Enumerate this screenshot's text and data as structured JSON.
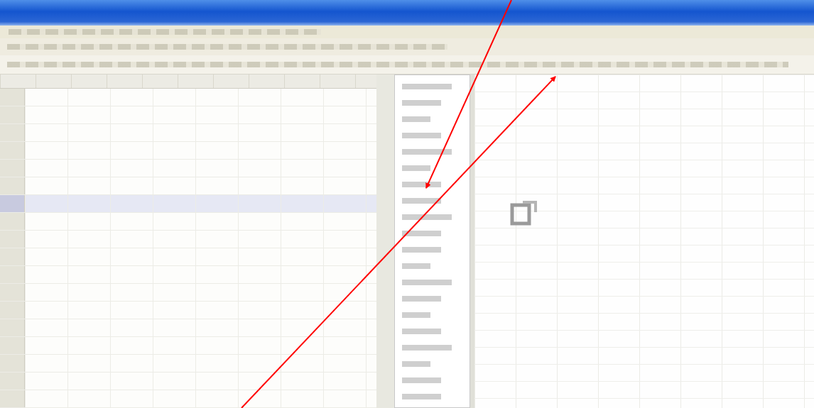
{
  "left_sheet": {
    "rows": [
      {
        "selected": false
      },
      {
        "selected": false
      },
      {
        "selected": false
      },
      {
        "selected": false
      },
      {
        "selected": false
      },
      {
        "selected": false
      },
      {
        "selected": true
      },
      {
        "selected": false
      },
      {
        "selected": false
      },
      {
        "selected": false
      },
      {
        "selected": false
      },
      {
        "selected": false
      },
      {
        "selected": false
      },
      {
        "selected": false
      },
      {
        "selected": false
      },
      {
        "selected": false
      },
      {
        "selected": false
      },
      {
        "selected": false
      }
    ]
  },
  "dropdown": {
    "items": [
      {
        "selected": false
      },
      {
        "selected": false
      },
      {
        "selected": false
      },
      {
        "selected": false
      },
      {
        "selected": false
      },
      {
        "selected": false
      },
      {
        "selected": false
      },
      {
        "selected": false
      },
      {
        "selected": false
      },
      {
        "selected": false
      },
      {
        "selected": false
      },
      {
        "selected": false
      },
      {
        "selected": false
      },
      {
        "selected": false
      },
      {
        "selected": false
      },
      {
        "selected": false
      },
      {
        "selected": false
      },
      {
        "selected": false
      },
      {
        "selected": false
      },
      {
        "selected": false
      }
    ]
  },
  "annotations": [
    {
      "kind": "arrow"
    },
    {
      "kind": "arrow"
    }
  ]
}
